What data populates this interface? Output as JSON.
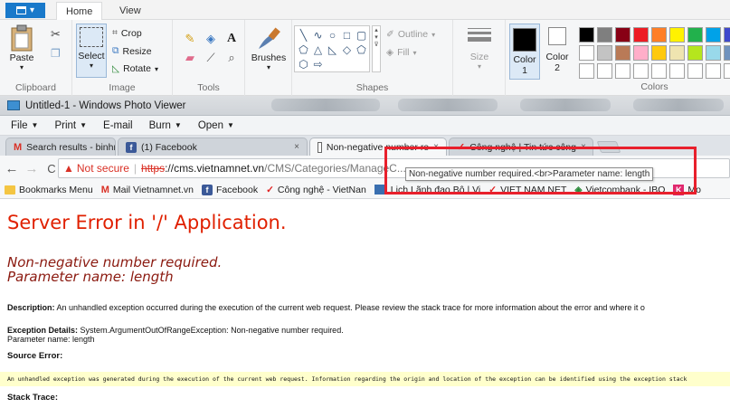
{
  "paint": {
    "tabs": [
      "Home",
      "View"
    ],
    "image_group": {
      "crop": "Crop",
      "resize": "Resize",
      "rotate": "Rotate",
      "select": "Select",
      "label": "Image"
    },
    "clipboard": {
      "paste": "Paste",
      "label": "Clipboard"
    },
    "tools_label": "Tools",
    "brushes": "Brushes",
    "shapes": {
      "outline": "Outline",
      "fill": "Fill",
      "label": "Shapes"
    },
    "size": "Size",
    "color1": {
      "title": "Color",
      "num": "1"
    },
    "color2": {
      "title": "Color",
      "num": "2"
    },
    "colors_label": "Colors",
    "palette_row1": [
      "#000000",
      "#7f7f7f",
      "#880015",
      "#ed1c24",
      "#ff7f27",
      "#fff200",
      "#22b14c",
      "#00a2e8",
      "#3f48cc",
      "#a349a4"
    ],
    "palette_row2": [
      "#ffffff",
      "#c3c3c3",
      "#b97a57",
      "#ffaec9",
      "#ffc90e",
      "#efe4b0",
      "#b5e61d",
      "#99d9ea",
      "#7092be",
      "#c8bfe7"
    ],
    "palette_row3": [
      "#ffffff",
      "#ffffff",
      "#ffffff",
      "#ffffff",
      "#ffffff",
      "#ffffff",
      "#ffffff",
      "#ffffff",
      "#ffffff",
      "#ffffff"
    ]
  },
  "photo_viewer": {
    "title": "Untitled-1 - Windows Photo Viewer",
    "menu": [
      "File",
      "Print",
      "E-mail",
      "Burn",
      "Open"
    ]
  },
  "browser": {
    "tabs": [
      {
        "title": "Search results - binhmini"
      },
      {
        "title": "(1) Facebook"
      },
      {
        "title": "Non-negative number re"
      },
      {
        "title": "Công nghệ | Tin tức công"
      }
    ],
    "address": {
      "not_secure": "Not secure",
      "scheme": "https",
      "host": "://cms.vietnamnet.vn",
      "path": "/CMS/Categories/ManageC..."
    },
    "bookmarks": [
      "Bookmarks Menu",
      "Mail Vietnamnet.vn",
      "Facebook",
      "Công nghệ - VietNan",
      "Lịch Lãnh đạo Bộ | Vi",
      "VIET NAM NET",
      "Vietcombank - IBO",
      "Mo"
    ],
    "tooltip": "Non-negative number required.<br>Parameter name: length"
  },
  "page": {
    "title": "Server Error in '/' Application.",
    "message_line1": "Non-negative number required.",
    "message_line2": "Parameter name: length",
    "description_label": "Description:",
    "description_text": "An unhandled exception occurred during the execution of the current web request. Please review the stack trace for more information about the error and where it o",
    "exception_label": "Exception Details:",
    "exception_text": "System.ArgumentOutOfRangeException: Non-negative number required.",
    "exception_param": "Parameter name: length",
    "source_error_label": "Source Error:",
    "source_error_text": "An unhandled exception was generated during the execution of the current web request. Information regarding the origin and location of the exception can be identified using the exception stack",
    "stack_trace_label": "Stack Trace:"
  }
}
